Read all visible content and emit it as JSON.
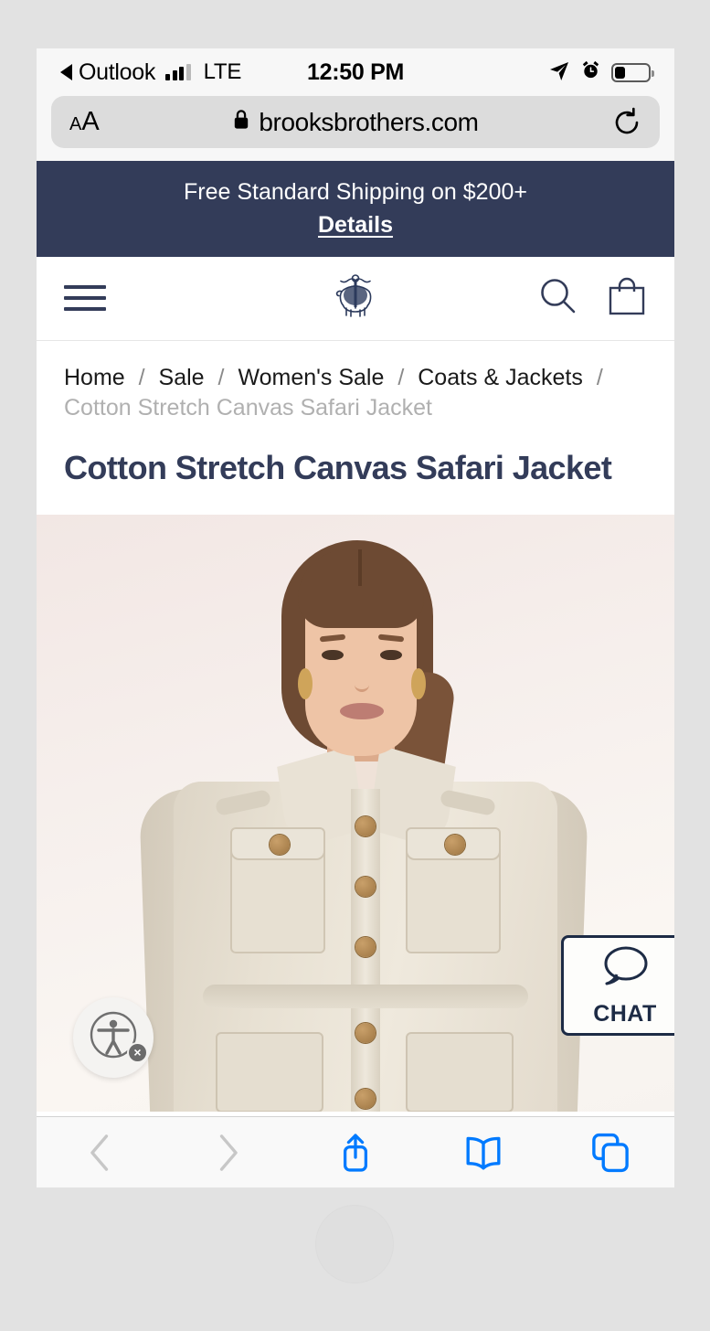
{
  "status_bar": {
    "back_app": "Outlook",
    "back_icon": "triangle-left-icon",
    "signal_icon": "cellular-bars-icon",
    "carrier": "LTE",
    "time": "12:50 PM",
    "location_icon": "location-arrow-icon",
    "alarm_icon": "alarm-clock-icon",
    "battery_icon": "battery-icon",
    "battery_level": 32
  },
  "browser": {
    "text_size_label": "AA",
    "lock_icon": "lock-icon",
    "url": "brooksbrothers.com",
    "reload_icon": "reload-icon",
    "toolbar": [
      {
        "name": "back-button",
        "icon": "chevron-left-icon",
        "enabled": false
      },
      {
        "name": "forward-button",
        "icon": "chevron-right-icon",
        "enabled": false
      },
      {
        "name": "share-button",
        "icon": "share-icon",
        "enabled": true
      },
      {
        "name": "bookmarks-button",
        "icon": "book-icon",
        "enabled": true
      },
      {
        "name": "tabs-button",
        "icon": "tabs-icon",
        "enabled": true
      }
    ],
    "accent_color": "#007aff",
    "disabled_color": "#c7c7c7"
  },
  "promo": {
    "message": "Free Standard Shipping on $200+",
    "link_label": "Details",
    "background_color": "#333c59"
  },
  "site_header": {
    "menu_icon": "hamburger-menu-icon",
    "logo_icon": "golden-fleece-logo-icon",
    "search_icon": "search-icon",
    "cart_icon": "shopping-bag-icon",
    "brand_color": "#333c59"
  },
  "breadcrumb": {
    "items": [
      {
        "label": "Home",
        "current": false
      },
      {
        "label": "Sale",
        "current": false
      },
      {
        "label": "Women's Sale",
        "current": false
      },
      {
        "label": "Coats & Jackets",
        "current": false
      },
      {
        "label": "Cotton Stretch Canvas Safari Jacket",
        "current": true
      }
    ],
    "separator": "/"
  },
  "product": {
    "title": "Cotton Stretch Canvas Safari Jacket",
    "image_alt": "Model wearing cream cotton stretch canvas safari jacket"
  },
  "accessibility_widget": {
    "icon": "accessibility-person-icon",
    "close_icon": "close-x-icon",
    "close_label": "×"
  },
  "chat": {
    "label": "CHAT",
    "icon": "chat-bubble-icon",
    "border_color": "#1d2b45"
  }
}
